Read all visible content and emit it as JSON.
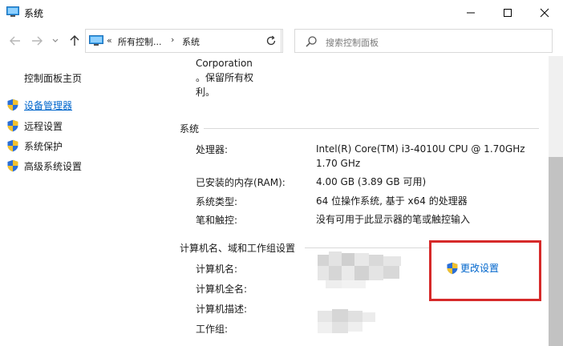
{
  "window": {
    "title": "系统"
  },
  "addressbar": {
    "overflow_chevron": "«",
    "crumb1": "所有控制...",
    "separator": "›",
    "crumb2": "系统",
    "dropdown": "⌄"
  },
  "search": {
    "placeholder": "搜索控制面板"
  },
  "sidebar": {
    "home": "控制面板主页",
    "items": [
      {
        "label": "设备管理器"
      },
      {
        "label": "远程设置"
      },
      {
        "label": "系统保护"
      },
      {
        "label": "高级系统设置"
      }
    ]
  },
  "content": {
    "copyright_lines": [
      "Corporation",
      "。保留所有权",
      "利。"
    ],
    "system": {
      "header": "系统",
      "rows": [
        {
          "label": "处理器:",
          "value": "Intel(R) Core(TM) i3-4010U CPU @ 1.70GHz",
          "value2": "1.70 GHz"
        },
        {
          "label": "已安装的内存(RAM):",
          "value": "4.00 GB (3.89 GB 可用)"
        },
        {
          "label": "系统类型:",
          "value": "64 位操作系统, 基于 x64 的处理器"
        },
        {
          "label": "笔和触控:",
          "value": "没有可用于此显示器的笔或触控输入"
        }
      ]
    },
    "computer": {
      "header": "计算机名、域和工作组设置",
      "rows": [
        {
          "label": "计算机名:"
        },
        {
          "label": "计算机全名:"
        },
        {
          "label": "计算机描述:"
        },
        {
          "label": "工作组:"
        }
      ],
      "change_link": "更改设置"
    }
  },
  "colors": {
    "link": "#0066cc",
    "highlight_box": "#d62a2a",
    "shield_blue": "#2b6fd6",
    "shield_yellow": "#f2c12e"
  }
}
